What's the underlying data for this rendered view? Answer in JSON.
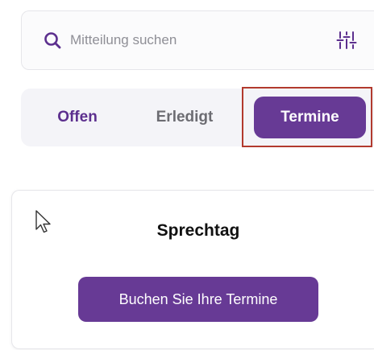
{
  "search": {
    "placeholder": "Mitteilung suchen",
    "icon": "search-icon",
    "filter_icon": "sliders-icon"
  },
  "tabs": [
    {
      "label": "Offen",
      "active": false
    },
    {
      "label": "Erledigt",
      "active": false
    },
    {
      "label": "Termine",
      "active": true
    }
  ],
  "card": {
    "title": "Sprechtag",
    "button_label": "Buchen Sie Ihre Termine"
  },
  "colors": {
    "accent": "#673a95",
    "accent_text": "#5c2f8e",
    "highlight": "#b23a2e",
    "tabs_background": "#f4f4f8"
  }
}
